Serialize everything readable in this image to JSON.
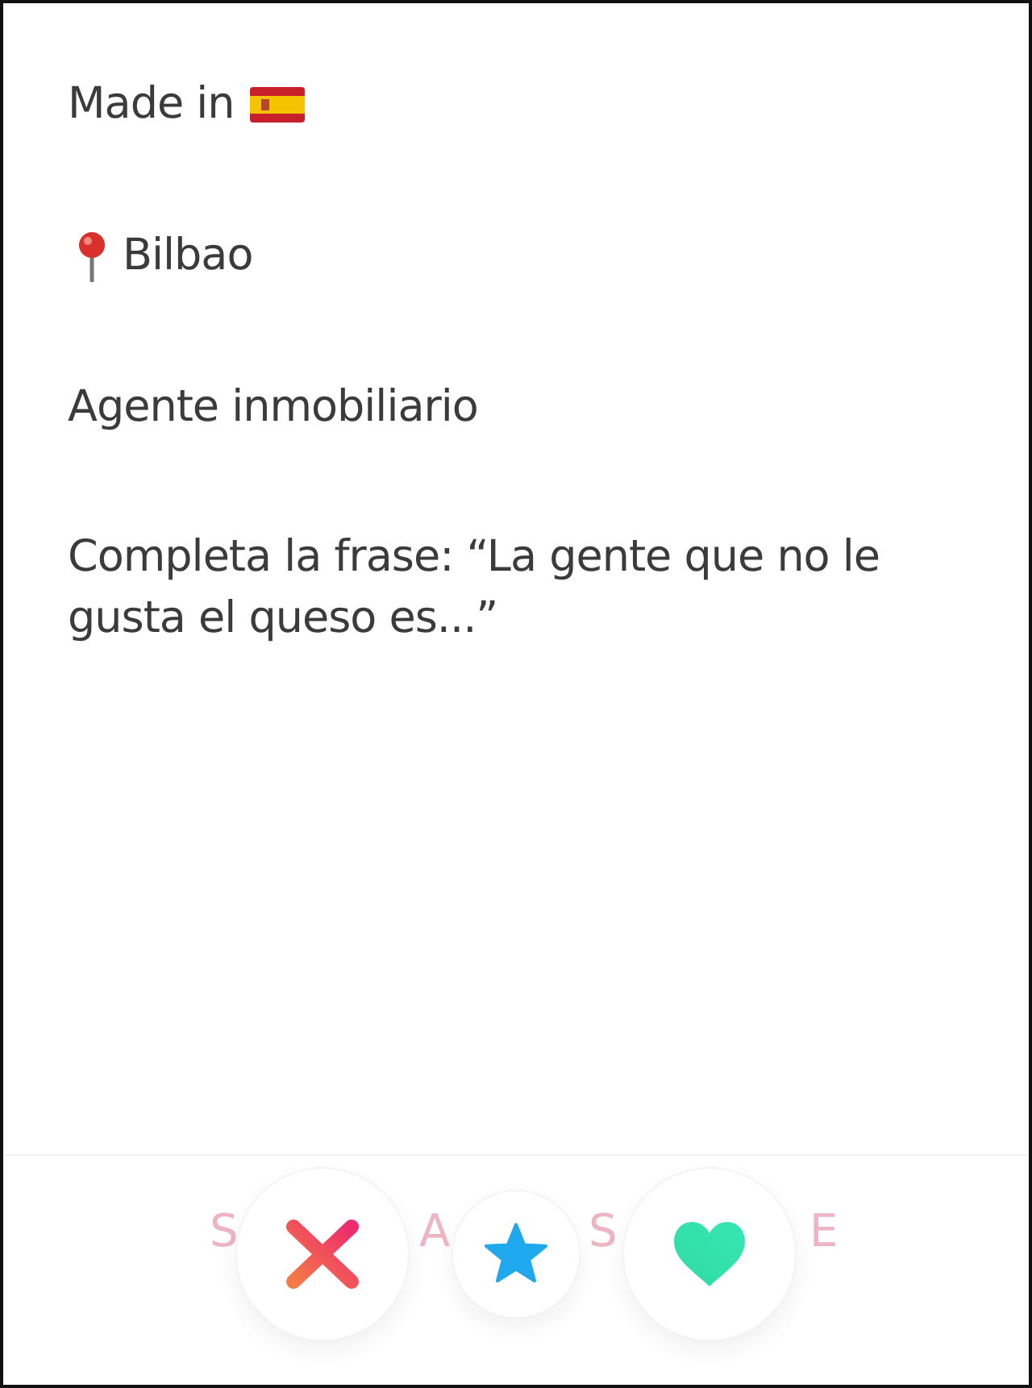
{
  "profile_lines": [
    {
      "text": "Made in",
      "kind": "flag"
    },
    {
      "text": "Bilbao",
      "kind": "pin"
    },
    {
      "text": "Agente inmobiliario",
      "kind": "plain"
    },
    {
      "text": "Completa la frase: “La gente que no le gusta el queso es...”",
      "kind": "plain"
    }
  ],
  "share_fragments": [
    "S",
    "A",
    "S",
    "E"
  ],
  "actions": [
    {
      "kind": "nope"
    },
    {
      "kind": "superlike"
    },
    {
      "kind": "like"
    }
  ]
}
